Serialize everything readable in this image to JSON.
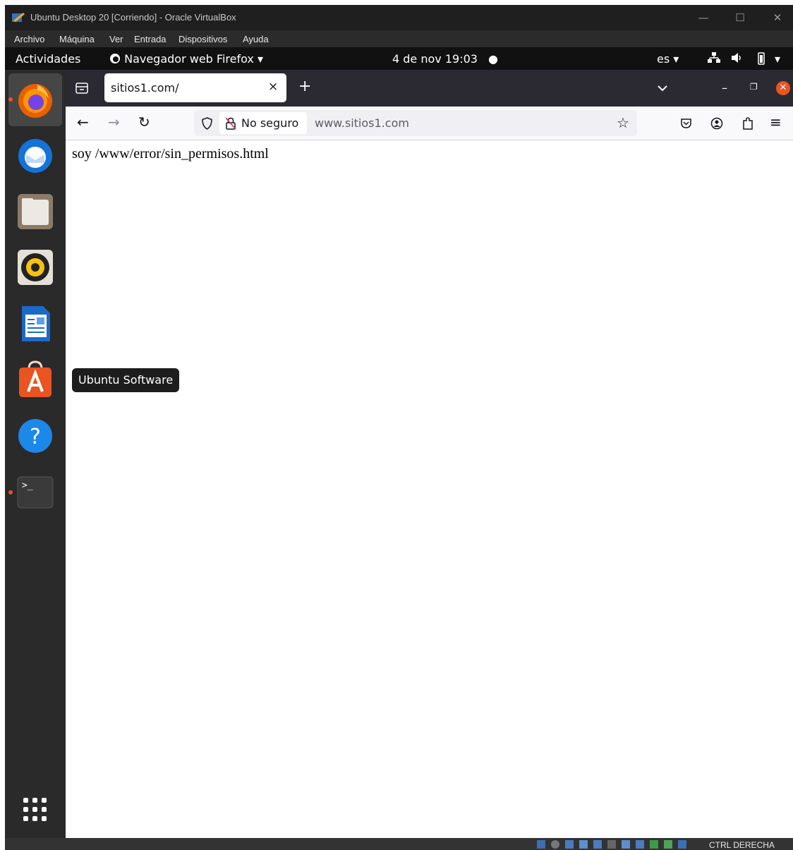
{
  "vbox": {
    "title": "Ubuntu Desktop 20 [Corriendo] - Oracle VirtualBox",
    "menu": [
      "Archivo",
      "Máquina",
      "Ver",
      "Entrada",
      "Dispositivos",
      "Ayuda"
    ],
    "host_key": "CTRL DERECHA"
  },
  "gnome": {
    "activities": "Actividades",
    "app_menu": "Navegador web Firefox",
    "clock": "4 de nov  19:03",
    "lang": "es"
  },
  "dock": {
    "tooltip": "Ubuntu Software",
    "apps": [
      "firefox-icon",
      "thunderbird-icon",
      "files-icon",
      "rhythmbox-icon",
      "libreoffice-writer-icon",
      "ubuntu-software-icon",
      "help-icon",
      "terminal-icon"
    ]
  },
  "firefox": {
    "tab_title": "sitios1.com/",
    "security_label": "No seguro",
    "url": "www.sitios1.com",
    "page_text": "soy /www/error/sin_permisos.html"
  },
  "colors": {
    "ubuntu_orange": "#e95420",
    "firefox_tabbar": "#2b2a33",
    "dock_bg": "#2a2a2a"
  }
}
